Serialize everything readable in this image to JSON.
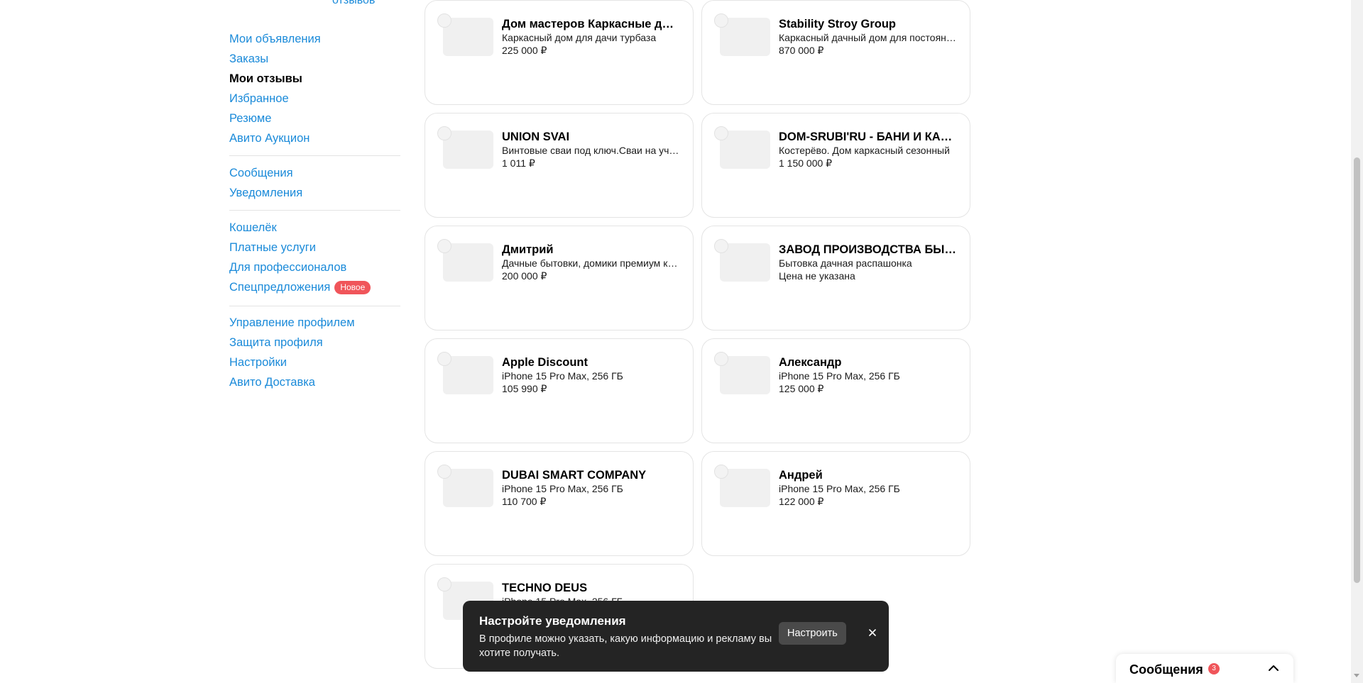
{
  "sidebar": {
    "top_left": "",
    "top_right": "отзывов",
    "groups": [
      {
        "items": [
          {
            "label": "Мои объявления"
          },
          {
            "label": "Заказы"
          },
          {
            "label": "Мои отзывы"
          },
          {
            "label": "Избранное"
          },
          {
            "label": "Резюме"
          },
          {
            "label": "Авито Аукцион"
          }
        ]
      },
      {
        "items": [
          {
            "label": "Сообщения"
          },
          {
            "label": "Уведомления"
          }
        ]
      },
      {
        "items": [
          {
            "label": "Кошелёк"
          },
          {
            "label": "Платные услуги"
          },
          {
            "label": "Для профессионалов"
          },
          {
            "label": "Спецпредложения",
            "badge": "Новое"
          }
        ]
      },
      {
        "items": [
          {
            "label": "Управление профилем"
          },
          {
            "label": "Защита профиля"
          },
          {
            "label": "Настройки"
          },
          {
            "label": "Авито Доставка"
          }
        ]
      }
    ],
    "active_item": "Мои отзывы"
  },
  "cards": [
    {
      "name": "Дом мастеров Каркасные дома",
      "desc": "Каркасный дом для дачи турбаза",
      "price": "225 000 ₽"
    },
    {
      "name": "Stability Stroy Group",
      "desc": "Каркасный дачный дом для постоянного проживания",
      "price": "870 000 ₽"
    },
    {
      "name": "UNION SVAI",
      "desc": "Винтовые сваи под ключ.Сваи на участок",
      "price": "1 011 ₽"
    },
    {
      "name": "DOM-SRUBI'RU - БАНИ И КАРКАСНЫЕ ДОМА",
      "desc": "Костерёво. Дом каркасный сезонный",
      "price": "1 150 000 ₽"
    },
    {
      "name": "Дмитрий",
      "desc": "Дачные бытовки, домики премиум класса",
      "price": "200 000 ₽"
    },
    {
      "name": "ЗАВОД ПРОИЗВОДСТВА БЫТОВОК",
      "desc": "Бытовка дачная распашонка",
      "price": "Цена не указана"
    },
    {
      "name": "Apple Discount",
      "desc": "iPhone 15 Pro Max, 256 ГБ",
      "price": "105 990 ₽"
    },
    {
      "name": "Александр",
      "desc": "iPhone 15 Pro Max, 256 ГБ",
      "price": "125 000 ₽"
    },
    {
      "name": "DUBAI SMART COMPANY",
      "desc": "iPhone 15 Pro Max, 256 ГБ",
      "price": "110 700 ₽"
    },
    {
      "name": "Андрей",
      "desc": "iPhone 15 Pro Max, 256 ГБ",
      "price": "122 000 ₽"
    },
    {
      "name": "TECHNO DEUS",
      "desc": "iPhone 15 Pro Max, 256 ГБ",
      "price": ""
    }
  ],
  "toast": {
    "title": "Настройте уведомления",
    "body": "В профиле можно указать, какую информацию и рекламу вы хотите получать.",
    "button": "Настроить",
    "close_icon": "close-icon"
  },
  "messages_widget": {
    "title": "Сообщения",
    "count": "3",
    "chevron_icon": "chevron-up-icon"
  },
  "colors": {
    "link": "#1a8ad9",
    "badge": "#f0555a",
    "toast_bg": "#242424"
  }
}
